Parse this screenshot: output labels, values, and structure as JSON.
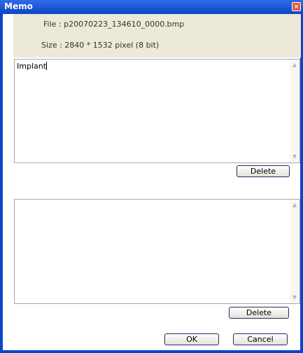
{
  "window": {
    "title": "Memo",
    "close_glyph": "✕"
  },
  "info": {
    "file_text": "File : p20070223_134610_0000.bmp",
    "size_text": "Size : 2840 * 1532 pixel (8 bit)"
  },
  "memo1": {
    "text": "Implant"
  },
  "memo2": {
    "text": ""
  },
  "buttons": {
    "delete_label": "Delete",
    "ok_label": "OK",
    "cancel_label": "Cancel"
  },
  "scrollbar": {
    "up_glyph": "▲",
    "down_glyph": "▼"
  },
  "colors": {
    "titlebar": "#0b46c8",
    "panel": "#ece9d8",
    "close": "#e0573f"
  }
}
